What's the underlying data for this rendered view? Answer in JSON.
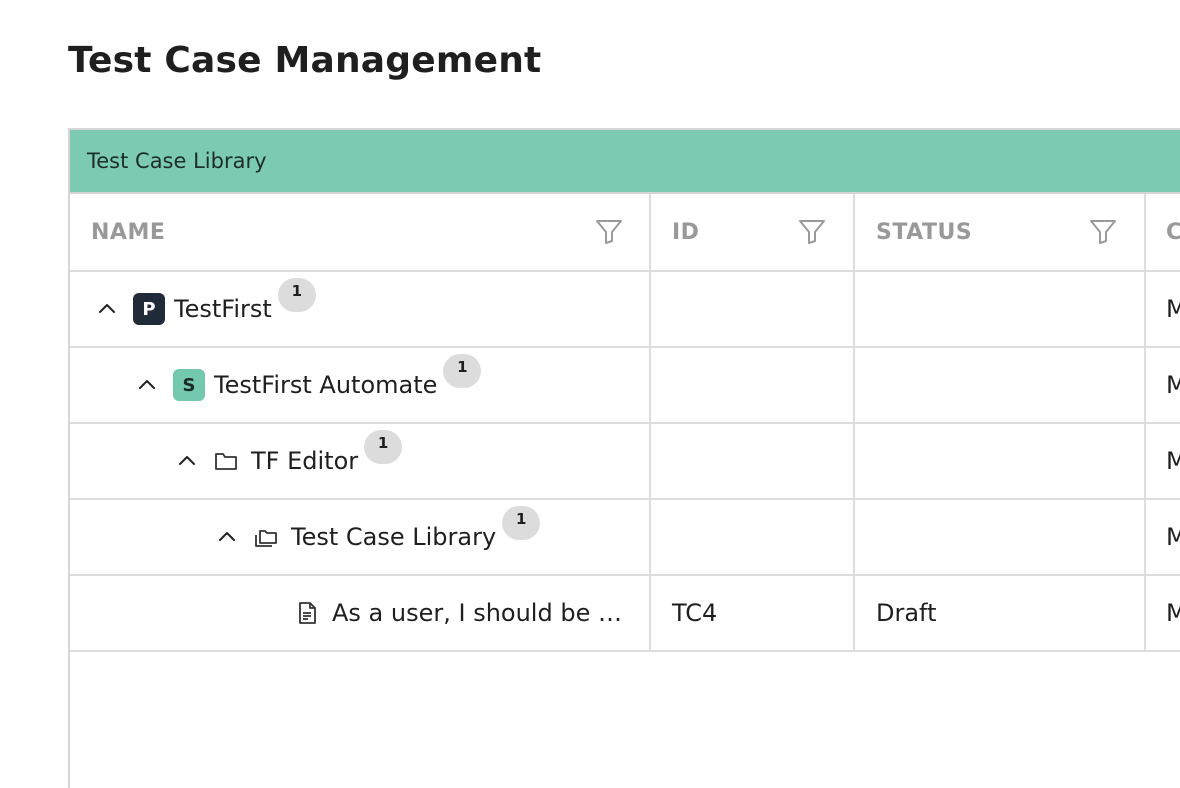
{
  "page": {
    "title": "Test Case Management"
  },
  "panel": {
    "title": "Test Case Library",
    "header_color": "#7dcab4"
  },
  "columns": [
    {
      "label": "NAME",
      "filter_icon": "filter-icon"
    },
    {
      "label": "ID",
      "filter_icon": "filter-icon"
    },
    {
      "label": "STATUS",
      "filter_icon": "filter-icon"
    },
    {
      "label": "C"
    }
  ],
  "rows": [
    {
      "type": "project",
      "badge": "P",
      "name": "TestFirst",
      "count": "1",
      "id": "",
      "status": "",
      "extra": "M",
      "expanded": true
    },
    {
      "type": "suite",
      "badge": "S",
      "name": "TestFirst Automate",
      "count": "1",
      "id": "",
      "status": "",
      "extra": "M",
      "expanded": true
    },
    {
      "type": "folder",
      "icon": "folder-icon",
      "name": "TF Editor",
      "count": "1",
      "id": "",
      "status": "",
      "extra": "M",
      "expanded": true
    },
    {
      "type": "library",
      "icon": "folders-icon",
      "name": "Test Case Library",
      "count": "1",
      "id": "",
      "status": "",
      "extra": "M",
      "expanded": true
    },
    {
      "type": "test-case",
      "icon": "document-icon",
      "name": "As a user, I should be a…",
      "id": "TC4",
      "status": "Draft",
      "extra": "M"
    }
  ]
}
